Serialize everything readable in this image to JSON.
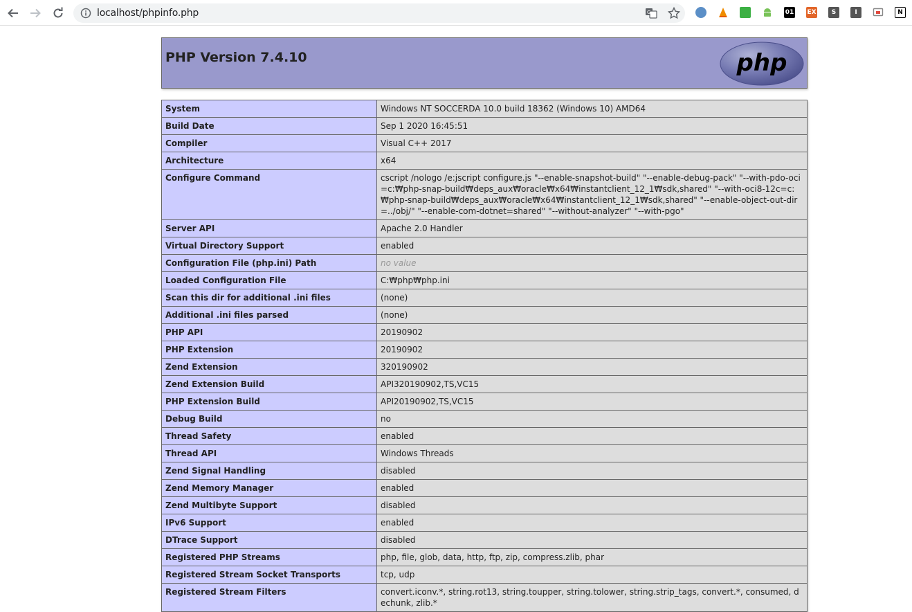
{
  "browser": {
    "url": "localhost/phpinfo.php",
    "extensions": [
      {
        "icon": "opera-ext-icon",
        "color": "#5b8fc7",
        "text": ""
      },
      {
        "icon": "vlc-icon",
        "color": "#f08c00",
        "text": ""
      },
      {
        "icon": "screen-green-icon",
        "color": "#3cb043",
        "text": ""
      },
      {
        "icon": "android-icon",
        "color": "#78c257",
        "text": ""
      },
      {
        "icon": "binary-01-icon",
        "color": "#000000",
        "text": "01"
      },
      {
        "icon": "ex-icon",
        "color": "#e2662a",
        "text": "EX"
      },
      {
        "icon": "s-ext-icon",
        "color": "#555555",
        "text": "S"
      },
      {
        "icon": "i-ext-icon",
        "color": "#555555",
        "text": "I"
      },
      {
        "icon": "cast-icon",
        "color": "#888888",
        "text": ""
      },
      {
        "icon": "notion-icon",
        "color": "#000000",
        "text": "N"
      }
    ]
  },
  "page": {
    "title": "PHP Version 7.4.10",
    "logo_text": "php",
    "rows": [
      {
        "label": "System",
        "value": "Windows NT SOCCERDA 10.0 build 18362 (Windows 10) AMD64"
      },
      {
        "label": "Build Date",
        "value": "Sep 1 2020 16:45:51"
      },
      {
        "label": "Compiler",
        "value": "Visual C++ 2017"
      },
      {
        "label": "Architecture",
        "value": "x64"
      },
      {
        "label": "Configure Command",
        "value": "cscript /nologo /e:jscript configure.js \"--enable-snapshot-build\" \"--enable-debug-pack\" \"--with-pdo-oci=c:₩php-snap-build₩deps_aux₩oracle₩x64₩instantclient_12_1₩sdk,shared\" \"--with-oci8-12c=c:₩php-snap-build₩deps_aux₩oracle₩x64₩instantclient_12_1₩sdk,shared\" \"--enable-object-out-dir=../obj/\" \"--enable-com-dotnet=shared\" \"--without-analyzer\" \"--with-pgo\""
      },
      {
        "label": "Server API",
        "value": "Apache 2.0 Handler"
      },
      {
        "label": "Virtual Directory Support",
        "value": "enabled"
      },
      {
        "label": "Configuration File (php.ini) Path",
        "value": "no value",
        "novalue": true
      },
      {
        "label": "Loaded Configuration File",
        "value": "C:₩php₩php.ini"
      },
      {
        "label": "Scan this dir for additional .ini files",
        "value": "(none)"
      },
      {
        "label": "Additional .ini files parsed",
        "value": "(none)"
      },
      {
        "label": "PHP API",
        "value": "20190902"
      },
      {
        "label": "PHP Extension",
        "value": "20190902"
      },
      {
        "label": "Zend Extension",
        "value": "320190902"
      },
      {
        "label": "Zend Extension Build",
        "value": "API320190902,TS,VC15"
      },
      {
        "label": "PHP Extension Build",
        "value": "API20190902,TS,VC15"
      },
      {
        "label": "Debug Build",
        "value": "no"
      },
      {
        "label": "Thread Safety",
        "value": "enabled"
      },
      {
        "label": "Thread API",
        "value": "Windows Threads"
      },
      {
        "label": "Zend Signal Handling",
        "value": "disabled"
      },
      {
        "label": "Zend Memory Manager",
        "value": "enabled"
      },
      {
        "label": "Zend Multibyte Support",
        "value": "disabled"
      },
      {
        "label": "IPv6 Support",
        "value": "enabled"
      },
      {
        "label": "DTrace Support",
        "value": "disabled"
      },
      {
        "label": "Registered PHP Streams",
        "value": "php, file, glob, data, http, ftp, zip, compress.zlib, phar"
      },
      {
        "label": "Registered Stream Socket Transports",
        "value": "tcp, udp"
      },
      {
        "label": "Registered Stream Filters",
        "value": "convert.iconv.*, string.rot13, string.toupper, string.tolower, string.strip_tags, convert.*, consumed, dechunk, zlib.*"
      }
    ]
  }
}
